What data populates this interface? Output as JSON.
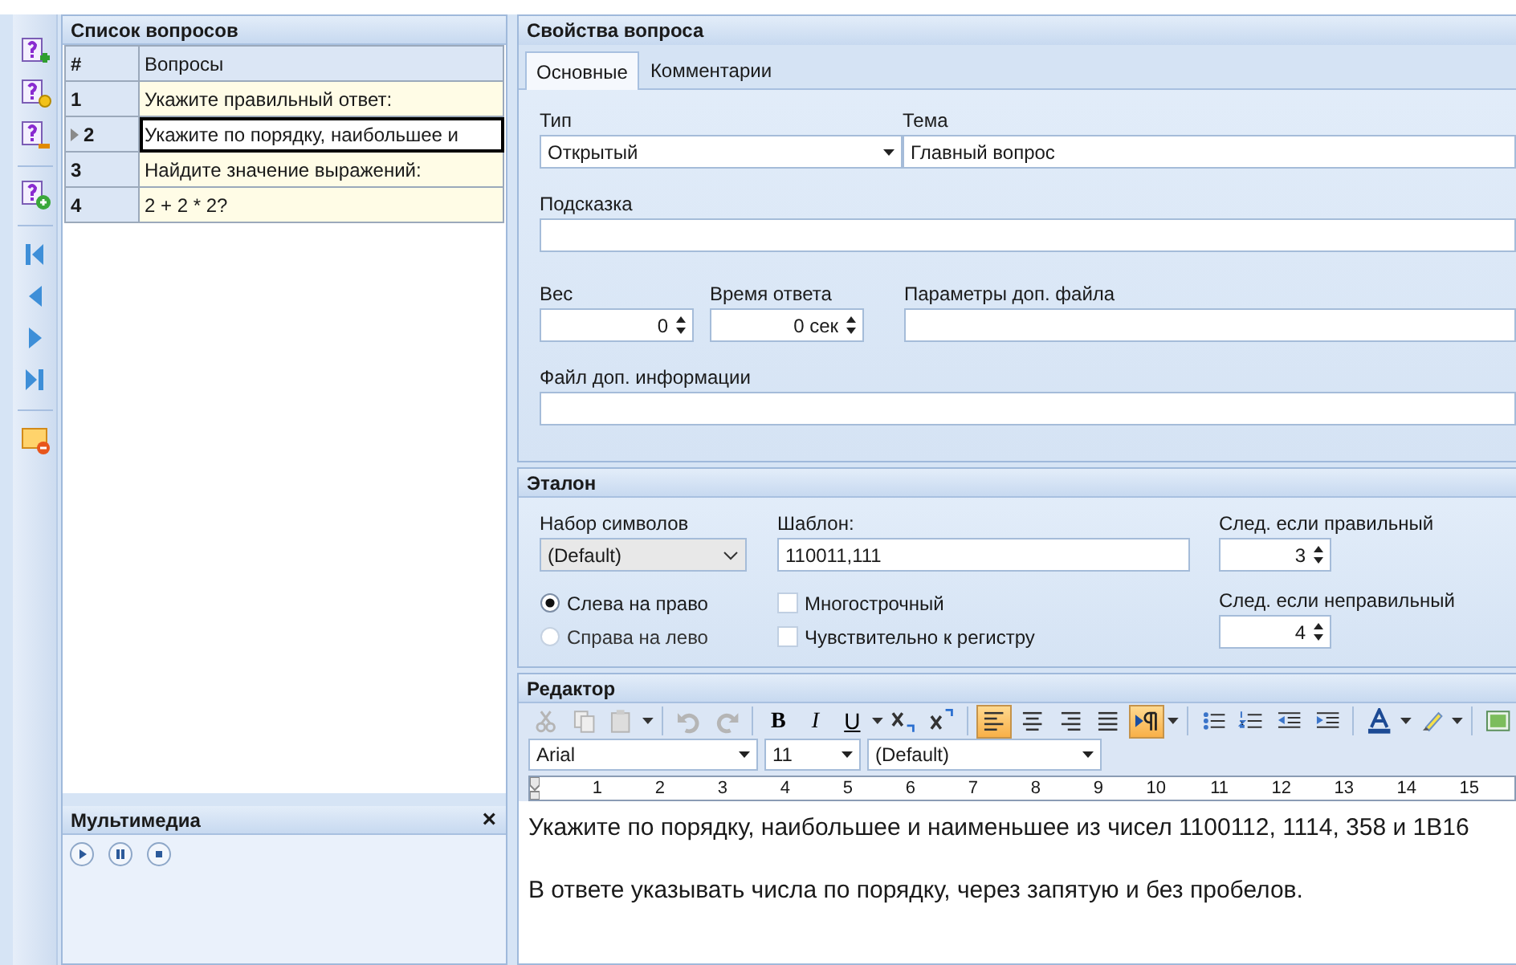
{
  "questions_panel": {
    "title": "Список вопросов",
    "columns": [
      "#",
      "Вопросы"
    ],
    "rows": [
      {
        "number": "1",
        "text": "Укажите правильный ответ:",
        "selected": false
      },
      {
        "number": "2",
        "text": "Укажите по порядку, наибольшее и",
        "selected": true
      },
      {
        "number": "3",
        "text": "Найдите значение выражений:",
        "selected": false
      },
      {
        "number": "4",
        "text": "2 + 2 * 2?",
        "selected": false
      }
    ]
  },
  "multimedia": {
    "title": "Мультимедиа",
    "close": "×"
  },
  "properties": {
    "title": "Свойства вопроса",
    "tabs": [
      {
        "label": "Основные",
        "selected": true
      },
      {
        "label": "Комментарии",
        "selected": false
      }
    ],
    "type": {
      "label": "Тип",
      "value": "Открытый"
    },
    "topic": {
      "label": "Тема",
      "value": "Главный вопрос"
    },
    "hint": {
      "label": "Подсказка"
    },
    "weight": {
      "label": "Вес",
      "value": "0"
    },
    "time": {
      "label": "Время ответа",
      "value": "0 сек"
    },
    "file_params": {
      "label": "Параметры доп. файла"
    },
    "info_file": {
      "label": "Файл доп. информации"
    }
  },
  "standard": {
    "title": "Эталон",
    "charset": {
      "label": "Набор символов",
      "value": "(Default)"
    },
    "template": {
      "label": "Шаблон:",
      "value": "110011,111"
    },
    "next_correct": {
      "label": "След. если правильный",
      "value": "3"
    },
    "next_wrong": {
      "label": "След. если неправильный",
      "value": "4"
    },
    "direction": [
      {
        "label": "Слева на право",
        "selected": true
      },
      {
        "label": "Справа на лево",
        "selected": false
      }
    ],
    "options": [
      {
        "label": "Многострочный",
        "checked": false
      },
      {
        "label": "Чувствительно к регистру",
        "checked": false
      }
    ]
  },
  "editor": {
    "title": "Редактор",
    "format_buttons": [
      {
        "label": "B"
      },
      {
        "label": "I"
      },
      {
        "label": "U"
      }
    ],
    "align": [
      {
        "selected": true
      },
      {
        "selected": false
      },
      {
        "selected": false
      },
      {
        "selected": false
      }
    ],
    "paragraph_direction": {
      "on": true
    },
    "font": "Arial",
    "size": "11",
    "style": "(Default)",
    "ruler": [
      "1",
      "2",
      "3",
      "4",
      "5",
      "6",
      "7",
      "8",
      "9",
      "10",
      "11",
      "12",
      "13",
      "14",
      "15"
    ],
    "paragraphs": [
      "Укажите по порядку, наибольшее и наименьшее из чисел 1100112, 1114, 358 и 1В16",
      "В ответе указывать числа по порядку, через запятую и без пробелов."
    ]
  }
}
